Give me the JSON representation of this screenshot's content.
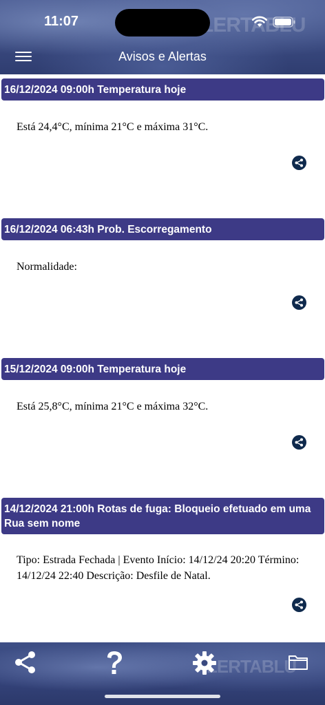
{
  "status_bar": {
    "time": "11:07"
  },
  "header": {
    "title": "Avisos e Alertas",
    "watermark": "LERTABLU"
  },
  "alerts": [
    {
      "title": "16/12/2024 09:00h Temperatura hoje",
      "body": "Está 24,4°C, mínima 21°C e máxima 31°C."
    },
    {
      "title": "16/12/2024 06:43h Prob. Escorregamento",
      "body": "Normalidade:"
    },
    {
      "title": "15/12/2024 09:00h Temperatura hoje",
      "body": "Está 25,8°C, mínima 21°C e máxima 32°C."
    },
    {
      "title": "14/12/2024 21:00h Rotas de fuga: Bloqueio efetuado em uma Rua sem nome",
      "body": "Tipo: Estrada Fechada | Evento Início: 14/12/24 20:20 Término: 14/12/24 22:40 Descrição: Desfile de Natal."
    }
  ],
  "toolbar": {
    "watermark": "LERTABLU",
    "icons": [
      "share-icon",
      "help-icon",
      "settings-icon",
      "folder-icon"
    ]
  },
  "colors": {
    "alert_header_bg": "#3d3a86",
    "share_button_bg": "#0f2a4d",
    "header_bg": "#3a4a80"
  }
}
